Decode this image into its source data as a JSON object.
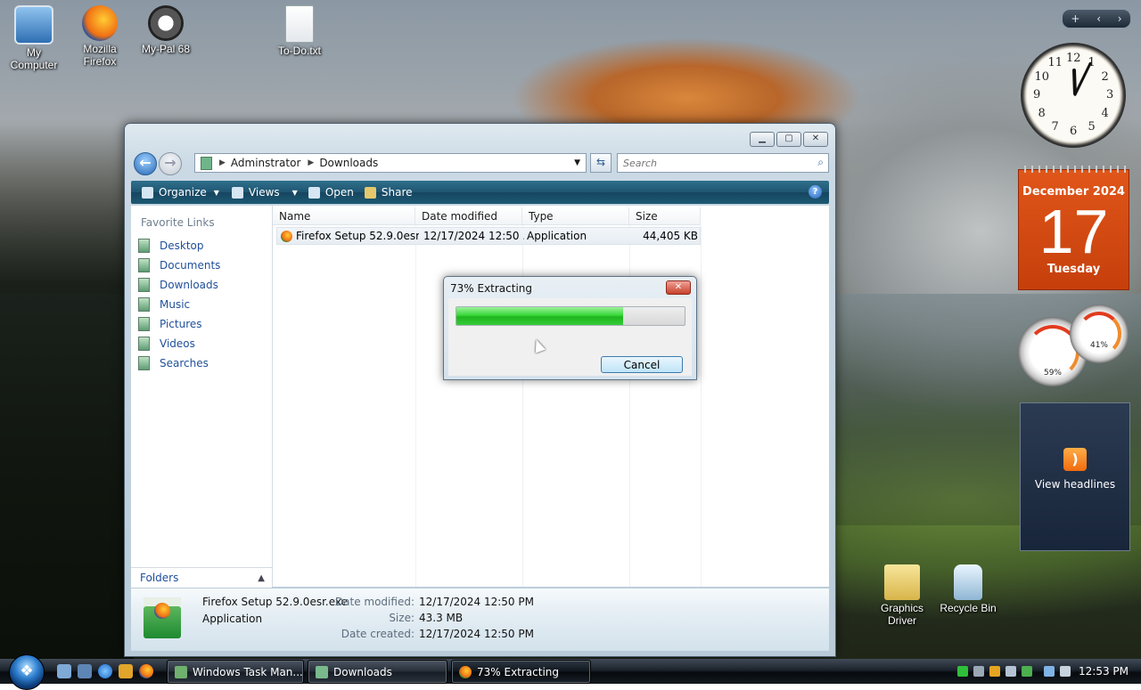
{
  "desktop_icons": [
    {
      "label_line1": "My",
      "label_line2": "Computer",
      "icon": "computer-icon"
    },
    {
      "label_line1": "Mozilla",
      "label_line2": "Firefox",
      "icon": "firefox-icon"
    },
    {
      "label_line1": "My-Pal 68",
      "label_line2": "",
      "icon": "raccoon-icon"
    },
    {
      "label_line1": "To-Do.txt",
      "label_line2": "",
      "icon": "text-file-icon"
    },
    {
      "label_line1": "Graphics",
      "label_line2": "Driver",
      "icon": "folder-icon"
    },
    {
      "label_line1": "Recycle Bin",
      "label_line2": "",
      "icon": "recycle-bin-icon"
    }
  ],
  "explorer": {
    "breadcrumb": [
      "Adminstrator",
      "Downloads"
    ],
    "search_placeholder": "Search",
    "toolbar": {
      "organize": "Organize",
      "views": "Views",
      "open": "Open",
      "share": "Share",
      "help": "?"
    },
    "favorite_links_title": "Favorite Links",
    "favorite_links": [
      "Desktop",
      "Documents",
      "Downloads",
      "Music",
      "Pictures",
      "Videos",
      "Searches"
    ],
    "folders_label": "Folders",
    "columns": [
      "Name",
      "Date modified",
      "Type",
      "Size"
    ],
    "files": [
      {
        "name": "Firefox Setup 52.9.0esr....",
        "date_modified": "12/17/2024 12:50 ...",
        "type": "Application",
        "size": "44,405 KB"
      }
    ],
    "details": {
      "name": "Firefox Setup 52.9.0esr.exe",
      "type": "Application",
      "date_modified_label": "Date modified:",
      "date_modified": "12/17/2024 12:50 PM",
      "size_label": "Size:",
      "size": "43.3 MB",
      "date_created_label": "Date created:",
      "date_created": "12/17/2024 12:50 PM"
    }
  },
  "progress_dialog": {
    "title": "73% Extracting",
    "progress_percent": 73,
    "cancel_label": "Cancel"
  },
  "gadgets": {
    "calendar": {
      "month_year": "December 2024",
      "day": "17",
      "weekday": "Tuesday"
    },
    "cpu_meter": {
      "cpu": "59%",
      "memory": "41%"
    },
    "feed": {
      "label": "View headlines"
    },
    "clock": {
      "numbers": [
        "12",
        "1",
        "2",
        "3",
        "4",
        "5",
        "6",
        "7",
        "8",
        "9",
        "10",
        "11"
      ]
    }
  },
  "taskbar": {
    "tasks": [
      "Windows Task Man...",
      "Downloads",
      "73% Extracting"
    ],
    "time": "12:53 PM"
  },
  "colors": {
    "toolbar_bg": "#1f5570",
    "link_blue": "#1f4f9a",
    "progress_green": "#3ad83a",
    "calendar_orange": "#d94e16"
  }
}
